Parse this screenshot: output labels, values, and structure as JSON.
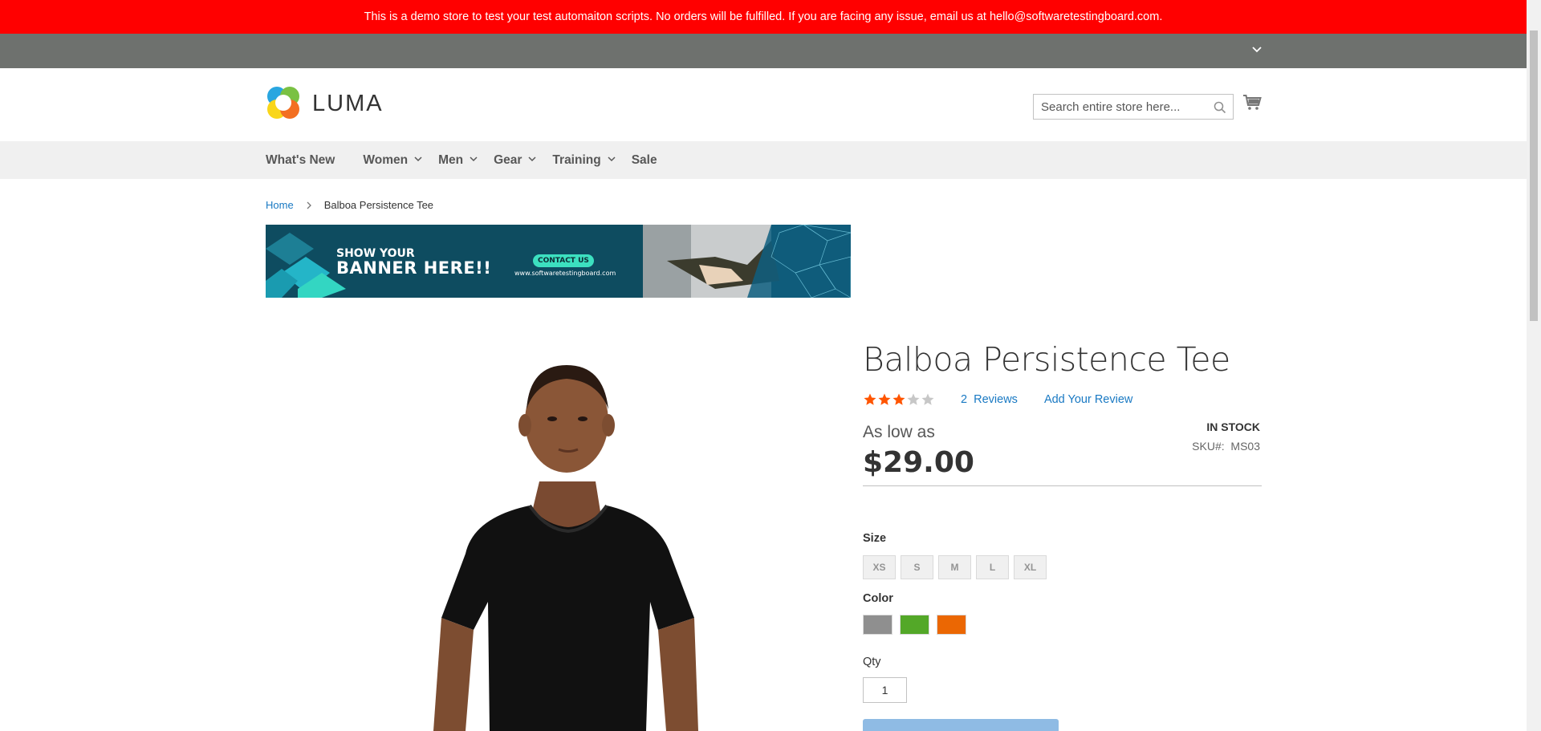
{
  "demo_notice": "This is a demo store to test your test automaiton scripts. No orders will be fulfilled. If you are facing any issue, email us at hello@softwaretestingboard.com.",
  "header": {
    "logo_text": "LUMA",
    "search_placeholder": "Search entire store here...",
    "search_icon": "search-icon",
    "cart_icon": "cart-icon"
  },
  "nav": {
    "items": [
      {
        "label": "What's New",
        "has_dropdown": false
      },
      {
        "label": "Women",
        "has_dropdown": true
      },
      {
        "label": "Men",
        "has_dropdown": true
      },
      {
        "label": "Gear",
        "has_dropdown": true
      },
      {
        "label": "Training",
        "has_dropdown": true
      },
      {
        "label": "Sale",
        "has_dropdown": false
      }
    ]
  },
  "breadcrumb": {
    "home": "Home",
    "current": "Balboa Persistence Tee"
  },
  "banner": {
    "line1": "SHOW YOUR",
    "line2": "BANNER HERE!!",
    "button": "CONTACT US",
    "url": "www.softwaretestingboard.com"
  },
  "product": {
    "title": "Balboa Persistence Tee",
    "rating": 3,
    "rating_max": 5,
    "reviews_count": "2",
    "reviews_label": "Reviews",
    "add_review": "Add Your Review",
    "as_low_as": "As low as",
    "price": "$29.00",
    "stock": "IN STOCK",
    "sku_label": "SKU#:",
    "sku": "MS03",
    "size_label": "Size",
    "sizes": [
      "XS",
      "S",
      "M",
      "L",
      "XL"
    ],
    "color_label": "Color",
    "colors": [
      "#8f8f8f",
      "#53a828",
      "#eb6703"
    ],
    "qty_label": "Qty",
    "qty_value": "1"
  },
  "colors": {
    "notice_bg": "#ff0000",
    "panel_bg": "#6e716e",
    "nav_bg": "#f0f0f0",
    "link": "#1979c3",
    "star": "#ff5501",
    "button": "#8fbbe4"
  }
}
